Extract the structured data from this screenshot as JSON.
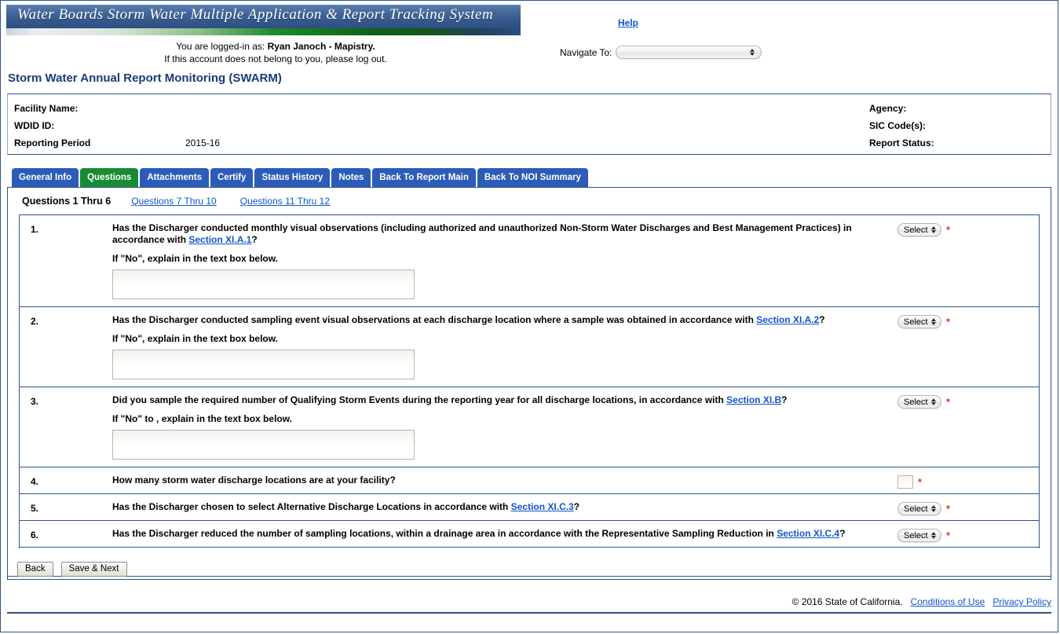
{
  "banner": {
    "title": "Water Boards  Storm Water Multiple Application & Report Tracking System"
  },
  "session": {
    "logged_in_prefix": "You are logged-in as: ",
    "user": "Ryan Janoch - Mapistry.",
    "logout_note": "If this account does not belong to you, please log out."
  },
  "header": {
    "help_label": "Help",
    "navigate_label": "Navigate To:",
    "navigate_value": "",
    "page_title": "Storm Water Annual Report Monitoring (SWARM)"
  },
  "info": {
    "left": [
      {
        "label": "Facility Name:",
        "value": ""
      },
      {
        "label": "WDID ID:",
        "value": ""
      },
      {
        "label": "Reporting Period",
        "value": "2015-16"
      }
    ],
    "right": [
      {
        "label": "Agency:",
        "value": ""
      },
      {
        "label": "SIC Code(s):",
        "value": ""
      },
      {
        "label": "Report Status:",
        "value": ""
      }
    ]
  },
  "tabs": [
    {
      "label": "General Info",
      "active": false
    },
    {
      "label": "Questions",
      "active": true
    },
    {
      "label": "Attachments",
      "active": false
    },
    {
      "label": "Certify",
      "active": false
    },
    {
      "label": "Status History",
      "active": false
    },
    {
      "label": "Notes",
      "active": false
    },
    {
      "label": "Back To Report Main",
      "active": false
    },
    {
      "label": "Back To NOI Summary",
      "active": false
    }
  ],
  "subtabs": {
    "current": "Questions 1 Thru 6",
    "links": [
      "Questions 7 Thru 10",
      "Questions 11 Thru 12"
    ]
  },
  "questions": [
    {
      "num": "1.",
      "text_a": "Has the Discharger conducted monthly visual observations (including authorized and unauthorized Non-Storm Water Discharges and Best Management Practices) in accordance with ",
      "link": "Section XI.A.1",
      "text_b": "?",
      "sub": "If \"No\", explain in the text box below.",
      "has_textarea": true,
      "textarea_value": "",
      "control": "select",
      "control_value": "Select",
      "required": "*"
    },
    {
      "num": "2.",
      "text_a": "Has the Discharger conducted sampling event visual observations at each discharge location where a sample was obtained in accordance with ",
      "link": "Section XI.A.2",
      "text_b": "?",
      "sub": "If \"No\", explain in the text box below.",
      "has_textarea": true,
      "textarea_value": "",
      "control": "select",
      "control_value": "Select",
      "required": "*"
    },
    {
      "num": "3.",
      "text_a": "Did you sample the required number of Qualifying Storm Events during the reporting year for all discharge locations, in accordance with ",
      "link": "Section XI.B",
      "text_b": "?",
      "sub": "If \"No\" to , explain in the text box below.",
      "has_textarea": true,
      "textarea_value": "",
      "control": "select",
      "control_value": "Select",
      "required": "*"
    },
    {
      "num": "4.",
      "text_a": "How many storm water discharge locations are at your facility?",
      "link": "",
      "text_b": "",
      "sub": "",
      "has_textarea": false,
      "textarea_value": "",
      "control": "input",
      "control_value": "",
      "required": "*"
    },
    {
      "num": "5.",
      "text_a": "Has the Discharger chosen to select Alternative Discharge Locations in accordance with ",
      "link": "Section XI.C.3",
      "text_b": "?",
      "sub": "",
      "has_textarea": false,
      "textarea_value": "",
      "control": "select",
      "control_value": "Select",
      "required": "*"
    },
    {
      "num": "6.",
      "text_a": "Has the Discharger reduced the number of sampling locations, within a drainage area in accordance with the Representative Sampling Reduction in ",
      "link": "Section XI.C.4",
      "text_b": "?",
      "sub": "",
      "has_textarea": false,
      "textarea_value": "",
      "control": "select",
      "control_value": "Select",
      "required": "*"
    }
  ],
  "buttons": {
    "back": "Back",
    "save_next": "Save & Next"
  },
  "footer": {
    "copyright": "© 2016 State of California.",
    "conditions": "Conditions of Use",
    "privacy": "Privacy Policy"
  },
  "colors": {
    "tab_blue": "#2c5cb8",
    "tab_green": "#198b32",
    "link_blue": "#1155cc",
    "frame_navy": "#2d5489",
    "required_red": "#e03a1a",
    "title_navy": "#1a3a7a"
  }
}
